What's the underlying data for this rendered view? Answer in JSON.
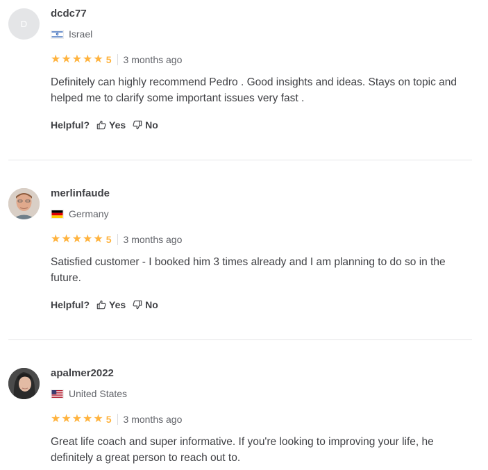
{
  "reviews": [
    {
      "avatar_letter": "D",
      "username": "dcdc77",
      "country": "Israel",
      "rating": "5",
      "time": "3 months ago",
      "text": "Definitely can highly recommend Pedro . Good insights and ideas. Stays on topic and helped me to clarify some important issues very fast .",
      "helpful_label": "Helpful?",
      "yes_label": "Yes",
      "no_label": "No"
    },
    {
      "username": "merlinfaude",
      "country": "Germany",
      "rating": "5",
      "time": "3 months ago",
      "text": "Satisfied customer - I booked him 3 times already and I am planning to do so in the future.",
      "helpful_label": "Helpful?",
      "yes_label": "Yes",
      "no_label": "No"
    },
    {
      "username": "apalmer2022",
      "country": "United States",
      "rating": "5",
      "time": "3 months ago",
      "text": "Great life coach and super informative. If you're looking to improving your life, he definitely a great person to reach out to."
    }
  ],
  "colors": {
    "star": "#ffb33e",
    "text": "#404145",
    "muted": "#62646a",
    "divider": "#e4e5e7"
  }
}
